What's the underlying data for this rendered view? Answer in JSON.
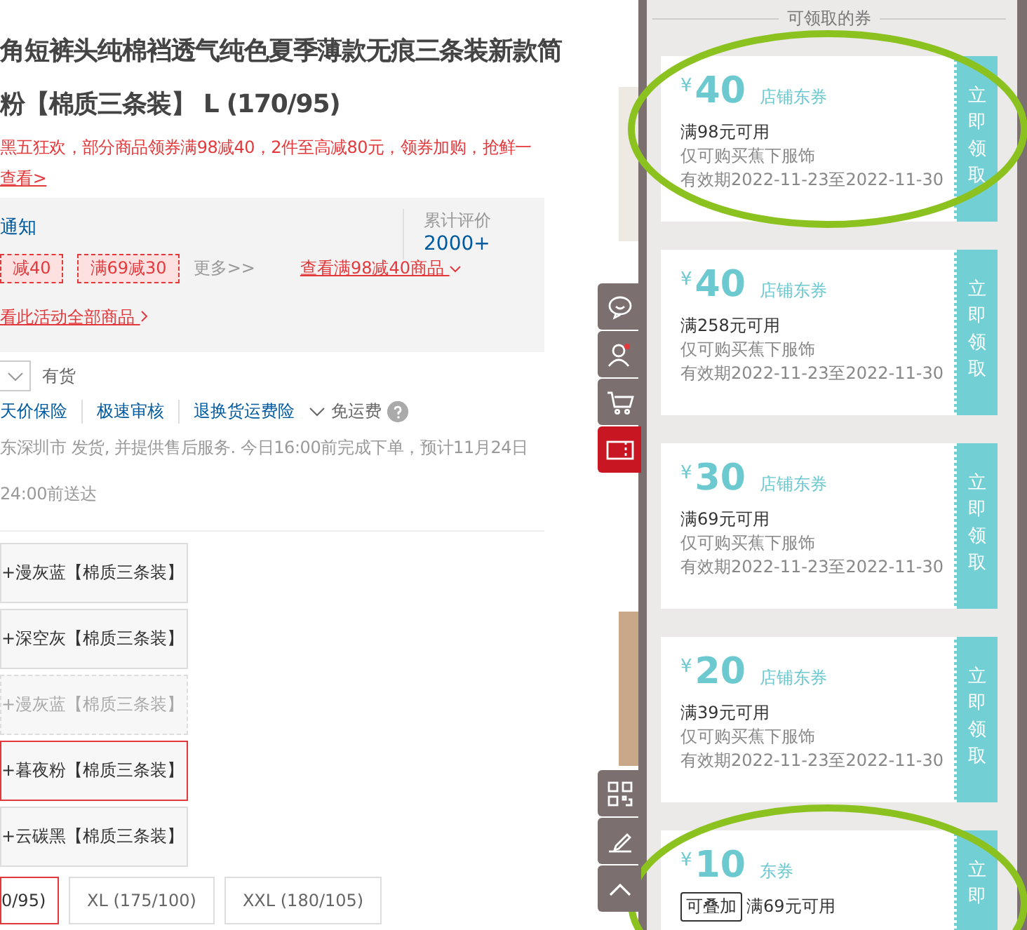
{
  "product": {
    "title_lines": [
      "角短裤头纯棉裆透气纯色夏季薄款无痕三条装新款简",
      "粉【棉质三条装】 L (170/95)"
    ],
    "promo": {
      "text": "黑五狂欢，部分商品领券满98减40，2件至高减80元，领券加购，抢鲜一",
      "link": "查看>"
    },
    "promo_box": {
      "notice": "通知",
      "tags": [
        "减40",
        "满69减30"
      ],
      "more": "更多>>",
      "view_link": "查看满98减40商品",
      "all_link": "看此活动全部商品",
      "reviews_label": "累计评价",
      "reviews_count": "2000+"
    },
    "stock": "有货",
    "services": [
      "天价保险",
      "极速审核",
      "退换货运费险"
    ],
    "free_shipping": "免运费",
    "shipping_lines": [
      "东深圳市 发货, 并提供售后服务. 今日16:00前完成下单，预计11月24日",
      "24:00前送达"
    ],
    "colors": [
      {
        "label": "+漫灰蓝【棉质三条装】",
        "selected": false,
        "disabled": false
      },
      {
        "label": "+深空灰【棉质三条装】",
        "selected": false,
        "disabled": false
      },
      {
        "label": "+漫灰蓝【棉质三条装】",
        "selected": false,
        "disabled": true
      },
      {
        "label": "+暮夜粉【棉质三条装】",
        "selected": true,
        "disabled": false
      },
      {
        "label": "+云碳黑【棉质三条装】",
        "selected": false,
        "disabled": false
      }
    ],
    "sizes": [
      {
        "label": "0/95)",
        "selected": true
      },
      {
        "label": "XL (175/100)",
        "selected": false
      },
      {
        "label": "XXL (180/105)",
        "selected": false
      }
    ]
  },
  "toolbar": [
    {
      "kind": "chat",
      "selected": false
    },
    {
      "kind": "user",
      "selected": false
    },
    {
      "kind": "cart",
      "selected": false
    },
    {
      "kind": "coupon",
      "selected": true
    },
    {
      "kind": "qr",
      "selected": false
    },
    {
      "kind": "edit",
      "selected": false
    },
    {
      "kind": "top",
      "selected": false
    }
  ],
  "drawer": {
    "title": "可领取的券",
    "coupons": [
      {
        "currency": "¥",
        "amount": "40",
        "type": "店铺东券",
        "condition": "满98元可用",
        "scope": "仅可购买蕉下服饰",
        "validity": "有效期2022-11-23至2022-11-30",
        "button": "立即领取",
        "circled": true
      },
      {
        "currency": "¥",
        "amount": "40",
        "type": "店铺东券",
        "condition": "满258元可用",
        "scope": "仅可购买蕉下服饰",
        "validity": "有效期2022-11-23至2022-11-30",
        "button": "立即领取",
        "circled": false
      },
      {
        "currency": "¥",
        "amount": "30",
        "type": "店铺东券",
        "condition": "满69元可用",
        "scope": "仅可购买蕉下服饰",
        "validity": "有效期2022-11-23至2022-11-30",
        "button": "立即领取",
        "circled": false
      },
      {
        "currency": "¥",
        "amount": "20",
        "type": "店铺东券",
        "condition": "满39元可用",
        "scope": "仅可购买蕉下服饰",
        "validity": "有效期2022-11-23至2022-11-30",
        "button": "立即领取",
        "circled": false
      },
      {
        "currency": "¥",
        "amount": "10",
        "type": "东券",
        "badge": "可叠加",
        "condition": "满69元可用",
        "button": "立即",
        "circled": true
      }
    ]
  }
}
